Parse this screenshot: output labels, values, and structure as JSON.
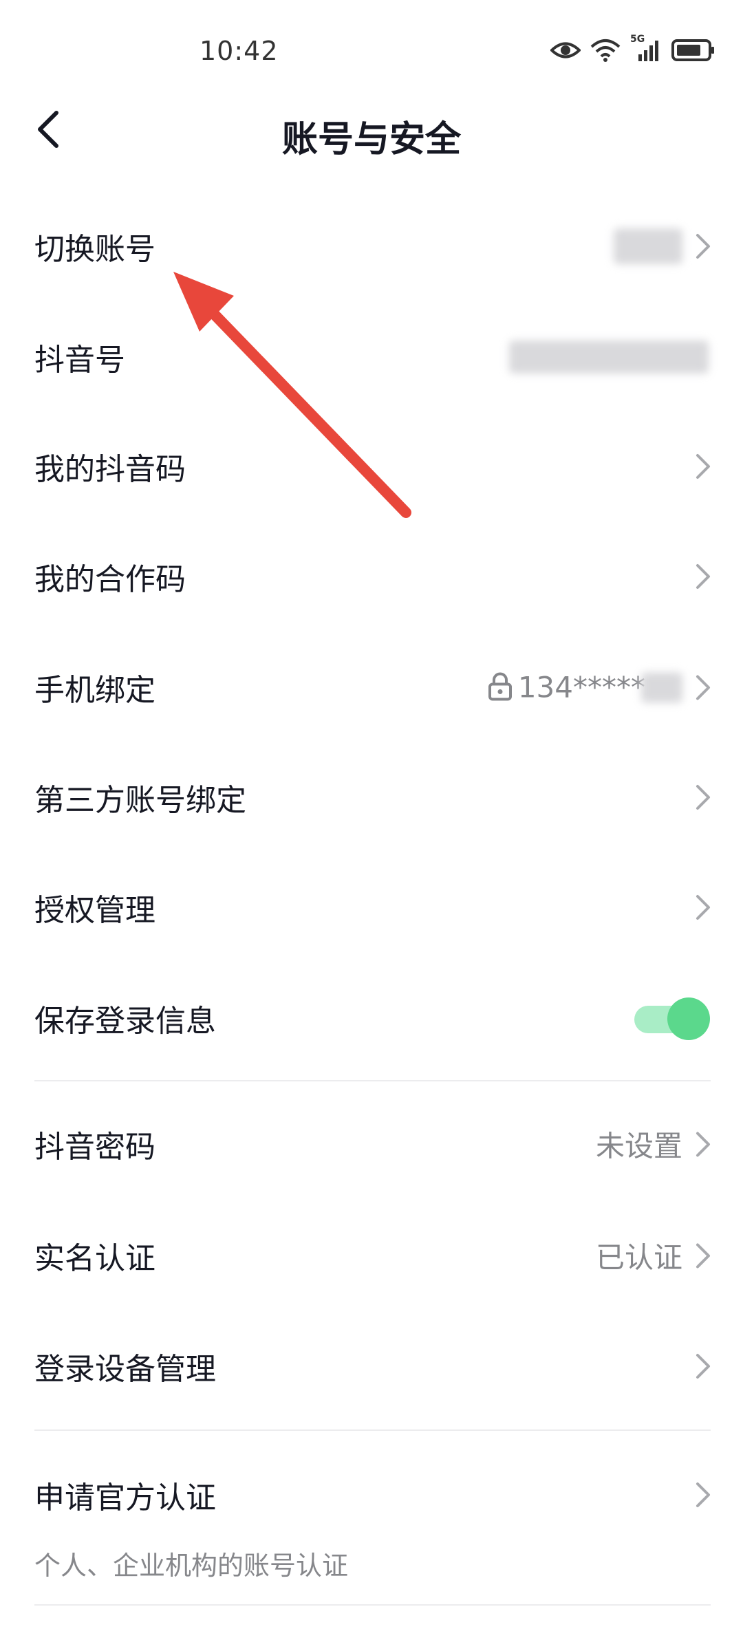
{
  "status_bar": {
    "time": "10:42",
    "network_label": "5G"
  },
  "header": {
    "title": "账号与安全"
  },
  "rows": [
    {
      "label": "切换账号"
    },
    {
      "label": "抖音号"
    },
    {
      "label": "我的抖音码"
    },
    {
      "label": "我的合作码"
    },
    {
      "label": "手机绑定",
      "value": "134*****"
    },
    {
      "label": "第三方账号绑定"
    },
    {
      "label": "授权管理"
    },
    {
      "label": "保存登录信息",
      "toggle_on": true
    },
    {
      "label": "抖音密码",
      "value": "未设置"
    },
    {
      "label": "实名认证",
      "value": "已认证"
    },
    {
      "label": "登录设备管理"
    },
    {
      "label": "申请官方认证",
      "sub": "个人、企业机构的账号认证"
    }
  ],
  "colors": {
    "accent_toggle": "#5bd88c",
    "annotation_arrow": "#e8473b",
    "secondary_text": "#86878b"
  },
  "icons": {
    "back": "chevron-left-icon",
    "row_arrow": "chevron-right-icon",
    "lock": "lock-icon",
    "eye": "eye-icon",
    "wifi": "wifi-icon",
    "signal": "signal-icon",
    "battery": "battery-icon"
  }
}
